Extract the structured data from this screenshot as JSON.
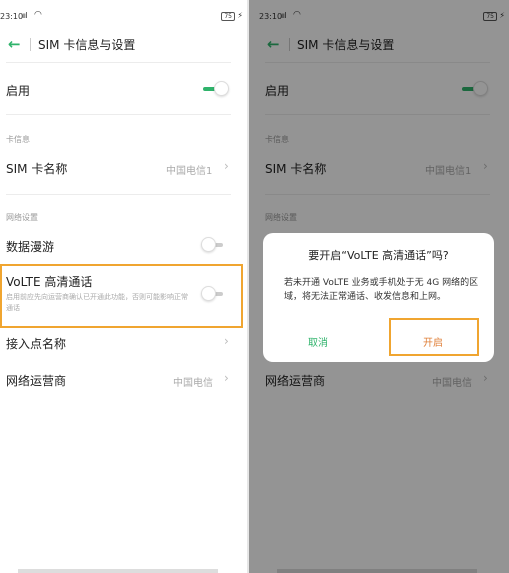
{
  "status_bar": {
    "time": "23:10",
    "signal": "ııl",
    "battery": "75",
    "wifi_icon": "wifi-icon",
    "charging_icon": "bolt-icon"
  },
  "header": {
    "back_icon": "back-arrow-icon",
    "back_glyph": "←",
    "title": "SIM 卡信息与设置"
  },
  "settings": {
    "enable": {
      "label": "启用",
      "toggle_on": true
    },
    "section_card": "卡信息",
    "sim_name": {
      "label": "SIM 卡名称",
      "value": "中国电信1"
    },
    "section_network": "网络设置",
    "roaming": {
      "label": "数据漫游",
      "toggle_on": false
    },
    "volte": {
      "label": "VoLTE 高清通话",
      "description": "启用前应先向运营商确认已开通此功能，否则可能影响正常通话",
      "toggle_on": false
    },
    "apn": {
      "label": "接入点名称"
    },
    "operator": {
      "label": "网络运营商",
      "value": "中国电信"
    }
  },
  "chevron": "›",
  "dialog": {
    "title": "要开启“VoLTE 高清通话”吗?",
    "body": "若未开通 VoLTE 业务或手机处于无 4G 网络的区域，将无法正常通话、收发信息和上网。",
    "cancel_label": "取消",
    "confirm_label": "开启"
  },
  "colors": {
    "accent": "#2fb36b",
    "highlight": "#f0a530",
    "confirm": "#e0803a"
  }
}
